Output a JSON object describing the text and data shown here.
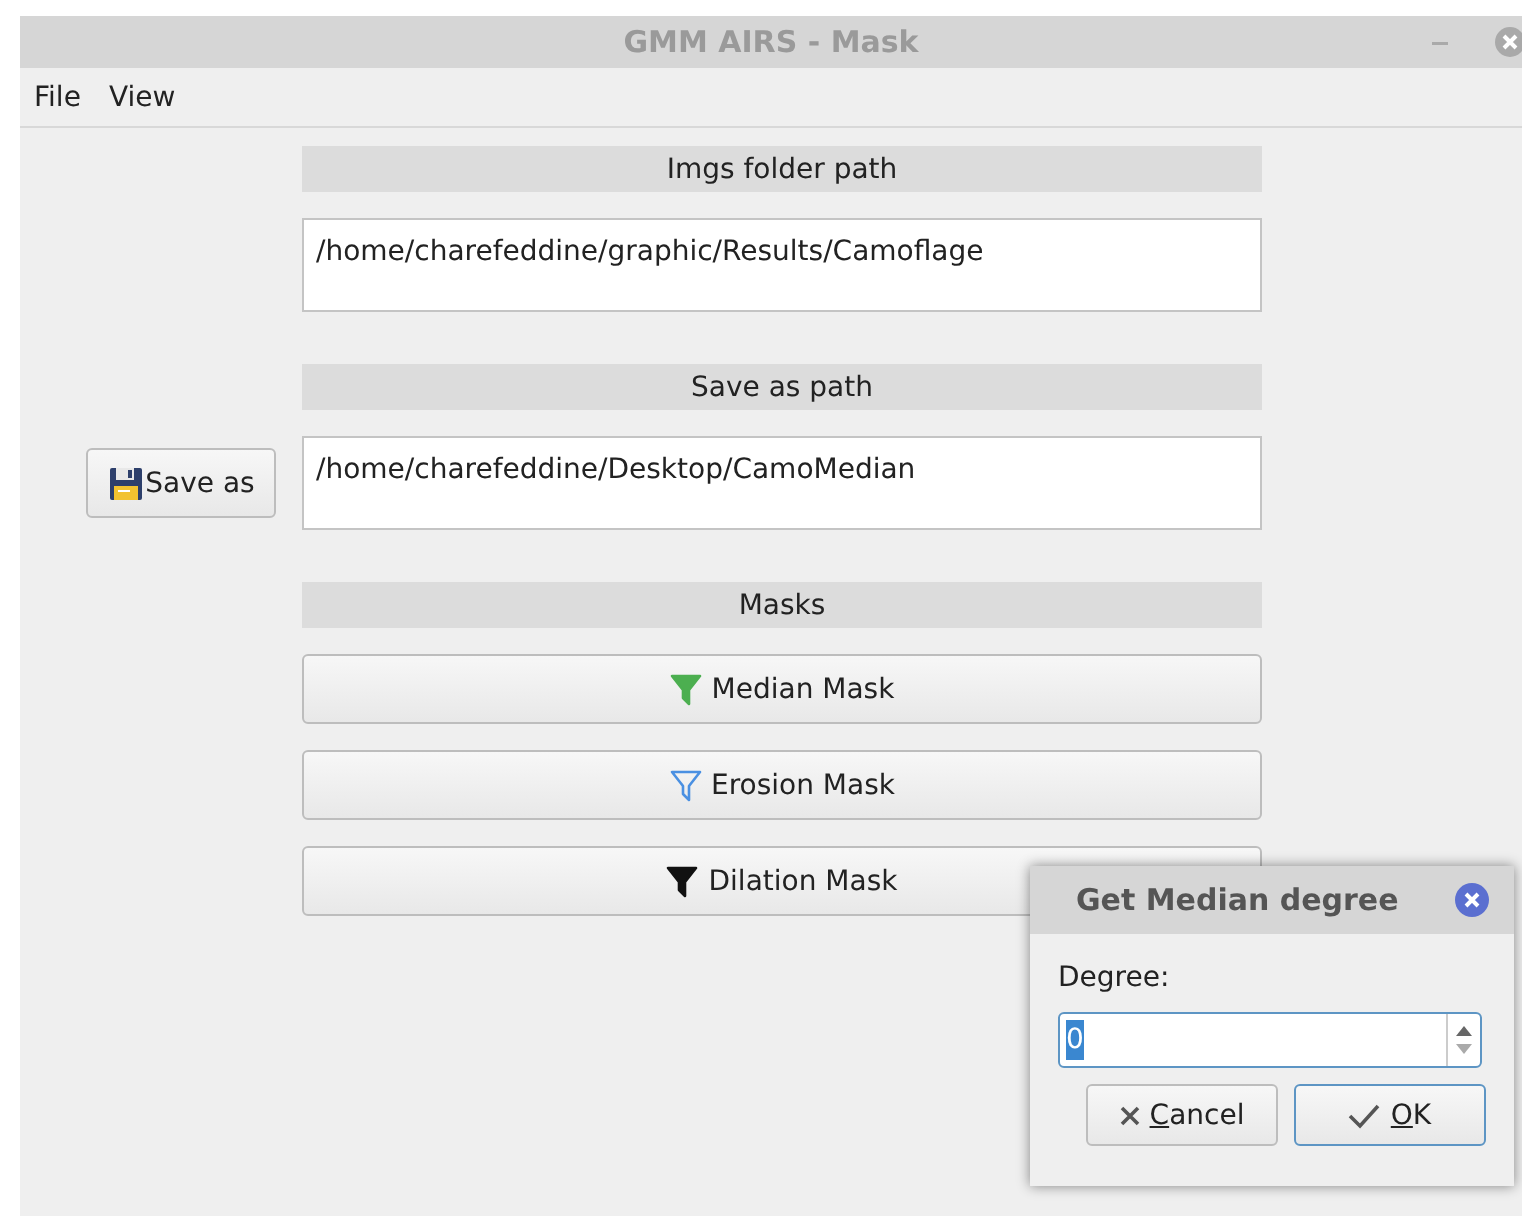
{
  "window": {
    "title": "GMM AIRS - Mask"
  },
  "menu": [
    "File",
    "View"
  ],
  "sections": [
    {
      "header": "Imgs folder path",
      "path": "/home/charefeddine/graphic/Results/Camoflage"
    },
    {
      "header": "Save as path",
      "path": "/home/charefeddine/Desktop/CamoMedian",
      "button": "Save as"
    }
  ],
  "masks": {
    "header": "Masks",
    "buttons": [
      {
        "label": "Median Mask",
        "color": "#4caf50",
        "kind": "filled"
      },
      {
        "label": "Erosion Mask",
        "color": "#4a90e2",
        "kind": "outline"
      },
      {
        "label": "Dilation Mask",
        "color": "#111111",
        "kind": "filled"
      }
    ]
  },
  "dialog": {
    "title": "Get Median degree",
    "label": "Degree:",
    "value": "0",
    "value_selected": true,
    "buttons": [
      {
        "label": "Cancel",
        "kind": "cancel",
        "default": false,
        "mnemonic": true
      },
      {
        "label": "OK",
        "kind": "ok",
        "default": true,
        "mnemonic": true
      }
    ]
  }
}
